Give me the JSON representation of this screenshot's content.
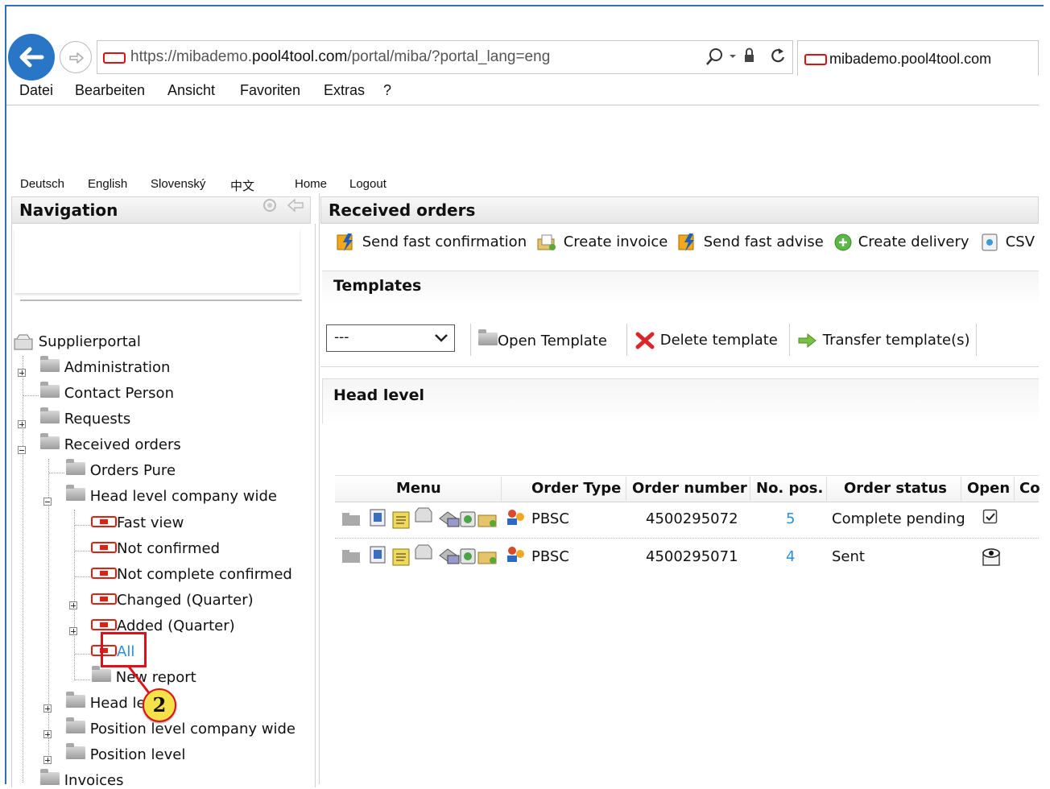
{
  "browser": {
    "url_prefix": "https://mibademo.",
    "url_domain": "pool4tool.com",
    "url_path": "/portal/miba/?portal_lang=eng",
    "tab_title": "mibademo.pool4tool.com",
    "menu": [
      "Datei",
      "Bearbeiten",
      "Ansicht",
      "Favoriten",
      "Extras",
      "?"
    ]
  },
  "portal": {
    "languages": [
      "Deutsch",
      "English",
      "Slovenský",
      "中文"
    ],
    "home": "Home",
    "logout": "Logout"
  },
  "navigation": {
    "title": "Navigation",
    "tree": {
      "root": "Supplierportal",
      "administration": "Administration",
      "contact_person": "Contact Person",
      "requests": "Requests",
      "received_orders": "Received orders",
      "orders_pure": "Orders Pure",
      "head_level_company_wide": "Head level company wide",
      "fast_view": "Fast view",
      "not_confirmed": "Not confirmed",
      "not_complete_confirmed": "Not complete confirmed",
      "changed_quarter": "Changed (Quarter)",
      "added_quarter": "Added (Quarter)",
      "all": "All",
      "new_report": "New report",
      "head_level": "Head level",
      "position_level_company_wide": "Position level company wide",
      "position_level": "Position level",
      "invoices": "Invoices"
    }
  },
  "main": {
    "title": "Received orders",
    "toolbar": {
      "send_fast_confirmation": "Send fast confirmation",
      "create_invoice": "Create invoice",
      "send_fast_advise": "Send fast advise",
      "create_delivery": "Create delivery",
      "csv": "CSV"
    },
    "templates": {
      "title": "Templates",
      "select_value": "---",
      "open_template": "Open Template",
      "delete_template": "Delete template",
      "transfer_template": "Transfer template(s)"
    },
    "head_level": {
      "title": "Head level",
      "columns": [
        "Menu",
        "Order Type",
        "Order number",
        "No. pos.",
        "Order status",
        "Open",
        "Co"
      ],
      "rows": [
        {
          "order_type": "PBSC",
          "order_number": "4500295072",
          "no_pos": "5",
          "status": "Complete pending",
          "open_icon": "checkbox-icon"
        },
        {
          "order_type": "PBSC",
          "order_number": "4500295071",
          "no_pos": "4",
          "status": "Sent",
          "open_icon": "eye-icon"
        }
      ]
    }
  },
  "annotation": {
    "step_number": "2",
    "colors": {
      "highlight": "#e0101a",
      "badge": "#f5e24a"
    }
  }
}
